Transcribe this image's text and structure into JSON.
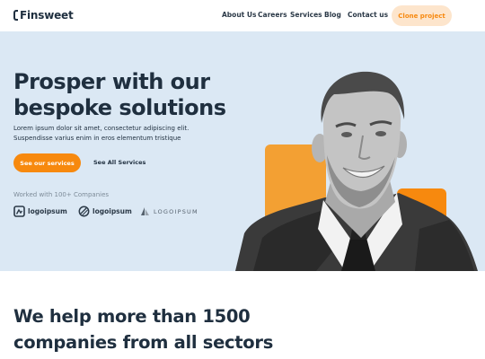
{
  "nav": {
    "brand": "Finsweet",
    "links": [
      "About Us",
      "Careers",
      "Services",
      "Blog",
      "Contact us"
    ],
    "cta": "Clone project"
  },
  "hero": {
    "title_line1": "Prosper with our",
    "title_line2": "bespoke solutions",
    "desc_line1": "Lorem ipsum dolor sit amet, consectetur adipiscing elit.",
    "desc_line2": "Suspendisse varius enim in eros elementum tristique",
    "primary_cta": "See our services",
    "secondary_cta": "See All Services",
    "worked_with": "Worked with 100+ Companies",
    "logos": [
      "logoipsum",
      "logoipsum",
      "LOGOIPSUM"
    ]
  },
  "stats": {
    "title_line1": "We help more than 1500",
    "title_line2": "companies from all sectors"
  },
  "colors": {
    "accent": "#f7890e",
    "accent_light": "#fde5cc",
    "hero_bg": "#dbe8f4",
    "text_dark": "#1f2f3f"
  }
}
